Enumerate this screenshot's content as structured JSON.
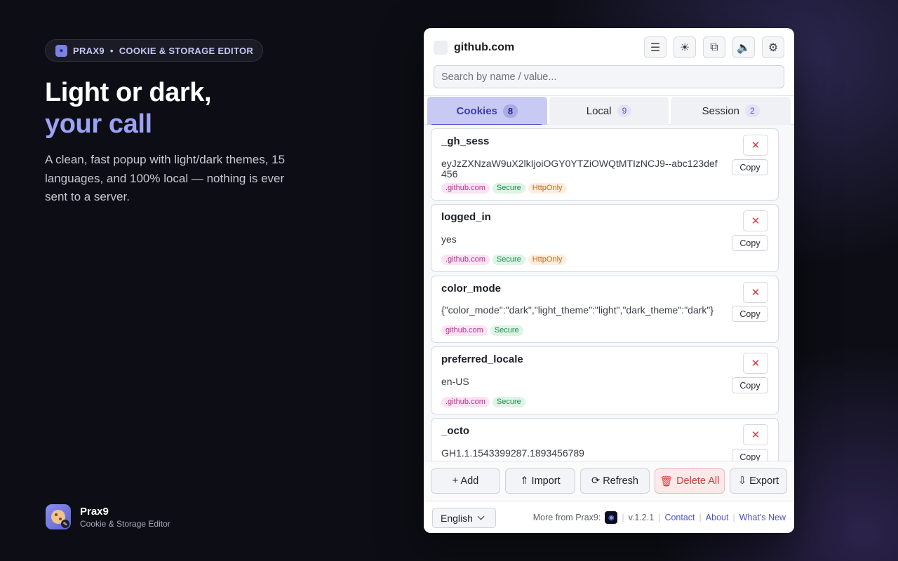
{
  "promo": {
    "badge_brand": "PRAX9",
    "badge_dot": "•",
    "badge_text": "COOKIE & STORAGE EDITOR",
    "headline_1": "Light or dark,",
    "headline_2": "your call",
    "description": "A clean, fast popup with light/dark themes, 15 languages, and 100% local — nothing is ever sent to a server.",
    "brand_name": "Prax9",
    "brand_sub": "Cookie & Storage Editor"
  },
  "popup": {
    "domain": "github.com",
    "header_icons": [
      "menu-icon",
      "sun-icon",
      "copy-window-icon",
      "speaker-icon",
      "gear-icon"
    ],
    "search_placeholder": "Search by name / value...",
    "tabs": [
      {
        "label": "Cookies",
        "count": "8",
        "active": true
      },
      {
        "label": "Local",
        "count": "9",
        "active": false
      },
      {
        "label": "Session",
        "count": "2",
        "active": false
      }
    ],
    "delete_glyph": "✕",
    "copy_label": "Copy",
    "cookies": [
      {
        "name": "_gh_sess",
        "value": "eyJzZXNzaW9uX2lkIjoiOGY0YTZiOWQtMTIzNCJ9--abc123def456",
        "tags": [
          ".github.com",
          "Secure",
          "HttpOnly"
        ]
      },
      {
        "name": "logged_in",
        "value": "yes",
        "tags": [
          ".github.com",
          "Secure",
          "HttpOnly"
        ]
      },
      {
        "name": "color_mode",
        "value": "{\"color_mode\":\"dark\",\"light_theme\":\"light\",\"dark_theme\":\"dark\"}",
        "tags": [
          "github.com",
          "Secure"
        ]
      },
      {
        "name": "preferred_locale",
        "value": "en-US",
        "tags": [
          ".github.com",
          "Secure"
        ]
      },
      {
        "name": "_octo",
        "value": "GH1.1.1543399287.1893456789",
        "tags": []
      }
    ],
    "actions": {
      "add": "+ Add",
      "import": "⇑ Import",
      "refresh": "⟳ Refresh",
      "delete_all": "Delete All",
      "export": "⇩ Export"
    },
    "footer": {
      "language": "English",
      "more_from": "More from Prax9:",
      "version": "v.1.2.1",
      "contact": "Contact",
      "about": "About",
      "whats_new": "What's New"
    }
  }
}
